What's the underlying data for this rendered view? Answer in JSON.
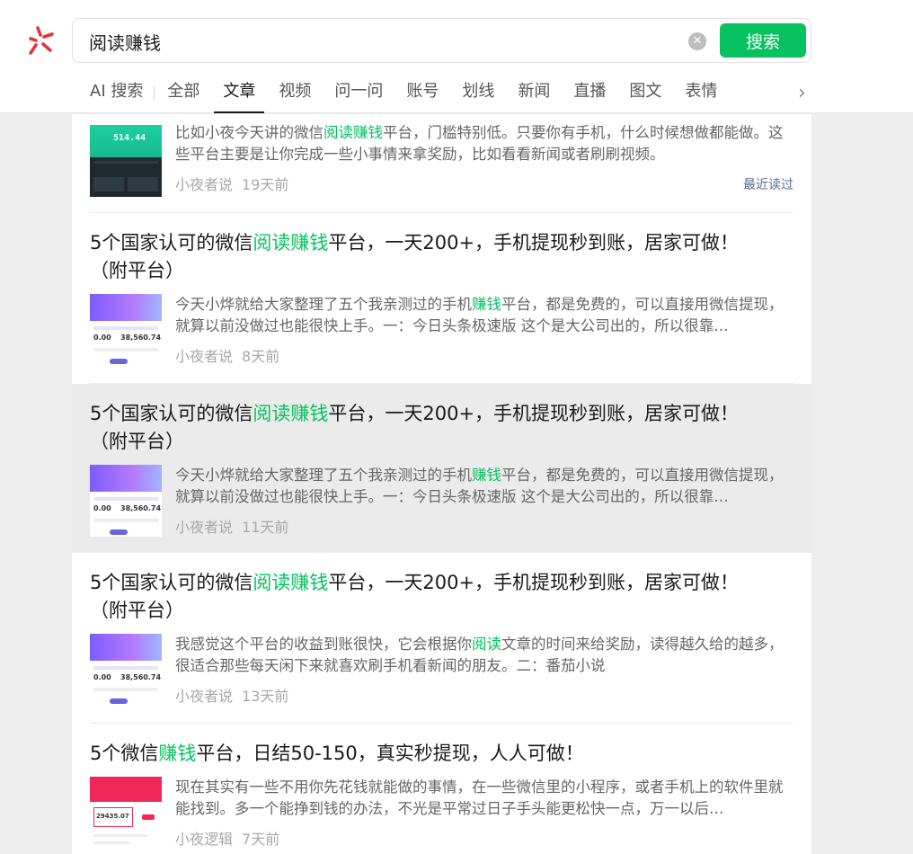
{
  "search": {
    "query": "阅读赚钱",
    "button_label": "搜索",
    "clear_symbol": "✕"
  },
  "tabs": [
    {
      "label": "AI 搜索"
    },
    {
      "label": "全部"
    },
    {
      "label": "文章",
      "active": true
    },
    {
      "label": "视频"
    },
    {
      "label": "问一问"
    },
    {
      "label": "账号"
    },
    {
      "label": "划线"
    },
    {
      "label": "新闻"
    },
    {
      "label": "直播"
    },
    {
      "label": "图文"
    },
    {
      "label": "表情"
    }
  ],
  "tabs_more_symbol": "›",
  "colors": {
    "accent": "#07c160",
    "link_blue": "#576b95",
    "highlight_row": "#ebebeb",
    "logo_red": "#e8323f"
  },
  "icons": {
    "logo": "wechat-search-logo-icon",
    "clear": "clear-icon",
    "more": "chevron-right-icon"
  },
  "results": [
    {
      "title": "",
      "summary_parts": [
        "比如小夜今天讲的微信",
        "阅读赚钱",
        "平台，门槛特别低。只要你有手机，什么时候想做都能做。这些平台主要是让你完成一些小事情来拿奖励，比如看看新闻或者刷刷视频。"
      ],
      "author": "小夜者说",
      "time": "19天前",
      "recent_label": "最近读过",
      "thumb": {
        "style": "dark",
        "text": "514.44"
      }
    },
    {
      "title_parts": [
        "5个国家认可的微信",
        "阅读赚钱",
        "平台，一天200+，手机提现秒到账，居家可做！（附平台）"
      ],
      "summary_parts": [
        "今天小烨就给大家整理了五个我亲测过的手机",
        "赚钱",
        "平台，都是免费的，可以直接用微信提现，就算以前没做过也能很快上手。一：今日头条极速版 这个是大公司出的，所以很靠…"
      ],
      "author": "小夜者说",
      "time": "8天前",
      "thumb": {
        "style": "purple",
        "n1": "0.00",
        "n2": "38,560.74"
      }
    },
    {
      "title_parts": [
        "5个国家认可的微信",
        "阅读赚钱",
        "平台，一天200+，手机提现秒到账，居家可做！（附平台）"
      ],
      "summary_parts": [
        "今天小烨就给大家整理了五个我亲测过的手机",
        "赚钱",
        "平台，都是免费的，可以直接用微信提现，就算以前没做过也能很快上手。一：今日头条极速版 这个是大公司出的，所以很靠…"
      ],
      "author": "小夜者说",
      "time": "11天前",
      "thumb": {
        "style": "purple",
        "n1": "0.00",
        "n2": "38,560.74"
      }
    },
    {
      "title_parts": [
        "5个国家认可的微信",
        "阅读赚钱",
        "平台，一天200+，手机提现秒到账，居家可做！（附平台）"
      ],
      "summary_parts": [
        "我感觉这个平台的收益到账很快，它会根据你",
        "阅读",
        "文章的时间来给奖励，读得越久给的越多，很适合那些每天闲下来就喜欢刷手机看新闻的朋友。二：番茄小说"
      ],
      "author": "小夜者说",
      "time": "13天前",
      "thumb": {
        "style": "purple",
        "n1": "0.00",
        "n2": "38,560.74"
      }
    },
    {
      "title_parts": [
        "5个微信",
        "赚钱",
        "平台，日结50-150，真实秒提现，人人可做！"
      ],
      "summary_parts": [
        "现在其实有一些不用你先花钱就能做的事情，在一些微信里的小程序，或者手机上的软件里就能找到。多一个能挣到钱的办法，不光是平常过日子手头能更松快一点，万一以后…",
        "",
        ""
      ],
      "author": "小夜逻辑",
      "time": "7天前",
      "thumb": {
        "style": "pink",
        "num": "29435.07"
      }
    }
  ]
}
